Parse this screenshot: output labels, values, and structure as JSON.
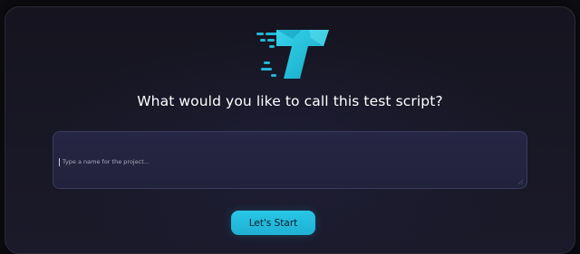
{
  "dialog": {
    "title": "What would you like to call this test script?",
    "input": {
      "value": "",
      "placeholder": "Type a name for the project..."
    },
    "start_button_label": "Let's Start"
  },
  "icons": {
    "logo": "brand-logo-icon",
    "resize": "resize-handle-icon"
  },
  "colors": {
    "accent": "#23bddd",
    "dialog_bg": "#1b1a2a",
    "input_bg": "#262645",
    "title_text": "#ffffff"
  }
}
